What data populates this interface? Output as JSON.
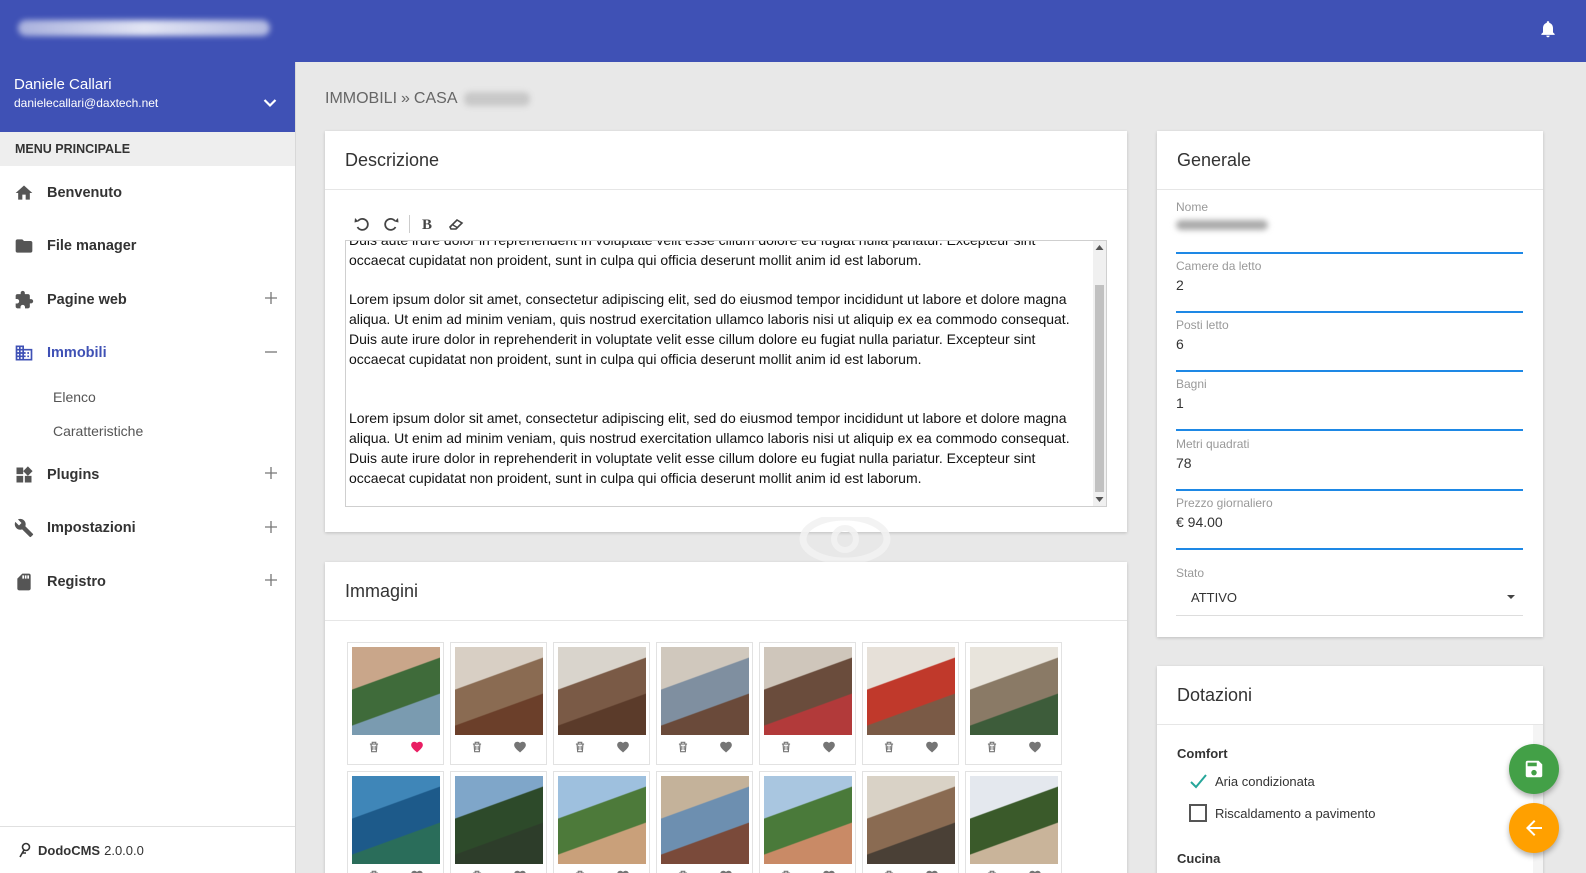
{
  "topbar": {
    "icon": "bell-icon"
  },
  "user": {
    "name": "Daniele Callari",
    "email": "danielecallari@daxtech.net"
  },
  "menu": {
    "header": "MENU PRINCIPALE",
    "items": [
      {
        "label": "Benvenuto",
        "icon": "home-icon"
      },
      {
        "label": "File manager",
        "icon": "folder-icon"
      },
      {
        "label": "Pagine web",
        "icon": "puzzle-icon"
      },
      {
        "label": "Immobili",
        "icon": "building-icon"
      },
      {
        "label": "Plugins",
        "icon": "widgets-icon"
      },
      {
        "label": "Impostazioni",
        "icon": "wrench-icon"
      },
      {
        "label": "Registro",
        "icon": "sd-card-icon"
      }
    ],
    "subitems": [
      "Elenco",
      "Caratteristiche"
    ]
  },
  "footer": {
    "app": "DodoCMS",
    "version": "2.0.0.0"
  },
  "breadcrumb": {
    "first": "IMMOBILI",
    "separator": "»",
    "second": "CASA"
  },
  "descrizione": {
    "title": "Descrizione",
    "paragraphs": [
      "Duis aute irure dolor in reprehenderit in voluptate velit esse cillum dolore eu fugiat nulla pariatur. Excepteur sint occaecat cupidatat non proident, sunt in culpa qui officia deserunt mollit anim id est laborum.",
      "Lorem ipsum dolor sit amet, consectetur adipiscing elit, sed do eiusmod tempor incididunt ut labore et dolore magna aliqua. Ut enim ad minim veniam, quis nostrud exercitation ullamco laboris nisi ut aliquip ex ea commodo consequat. Duis aute irure dolor in reprehenderit in voluptate velit esse cillum dolore eu fugiat nulla pariatur. Excepteur sint occaecat cupidatat non proident, sunt in culpa qui officia deserunt mollit anim id est laborum.",
      "Lorem ipsum dolor sit amet, consectetur adipiscing elit, sed do eiusmod tempor incididunt ut labore et dolore magna aliqua. Ut enim ad minim veniam, quis nostrud exercitation ullamco laboris nisi ut aliquip ex ea commodo consequat. Duis aute irure dolor in reprehenderit in voluptate velit esse cillum dolore eu fugiat nulla pariatur. Excepteur sint occaecat cupidatat non proident, sunt in culpa qui officia deserunt mollit anim id est laborum."
    ]
  },
  "immagini": {
    "title": "Immagini",
    "favorite_color": "#e91e63",
    "images": [
      {
        "favorite": true
      },
      {
        "favorite": false
      },
      {
        "favorite": false
      },
      {
        "favorite": false
      },
      {
        "favorite": false
      },
      {
        "favorite": false
      },
      {
        "favorite": false
      },
      {
        "favorite": false
      },
      {
        "favorite": false
      },
      {
        "favorite": false
      },
      {
        "favorite": false
      },
      {
        "favorite": false
      },
      {
        "favorite": false
      },
      {
        "favorite": false
      }
    ]
  },
  "generale": {
    "title": "Generale",
    "fields": [
      {
        "label": "Nome",
        "value": ""
      },
      {
        "label": "Camere da letto",
        "value": "2"
      },
      {
        "label": "Posti letto",
        "value": "6"
      },
      {
        "label": "Bagni",
        "value": "1"
      },
      {
        "label": "Metri quadrati",
        "value": "78"
      },
      {
        "label": "Prezzo giornaliero",
        "value": "€ 94.00"
      }
    ],
    "stato": {
      "label": "Stato",
      "value": "ATTIVO"
    }
  },
  "dotazioni": {
    "title": "Dotazioni",
    "groups": [
      {
        "name": "Comfort"
      },
      {
        "name": "Cucina"
      }
    ],
    "items": [
      {
        "label": "Aria condizionata",
        "checked": true
      },
      {
        "label": "Riscaldamento a pavimento",
        "checked": false
      }
    ]
  },
  "colors": {
    "primary": "#3f51b5",
    "accent": "#1e88e5",
    "save": "#43a047",
    "back": "#ffa000"
  }
}
